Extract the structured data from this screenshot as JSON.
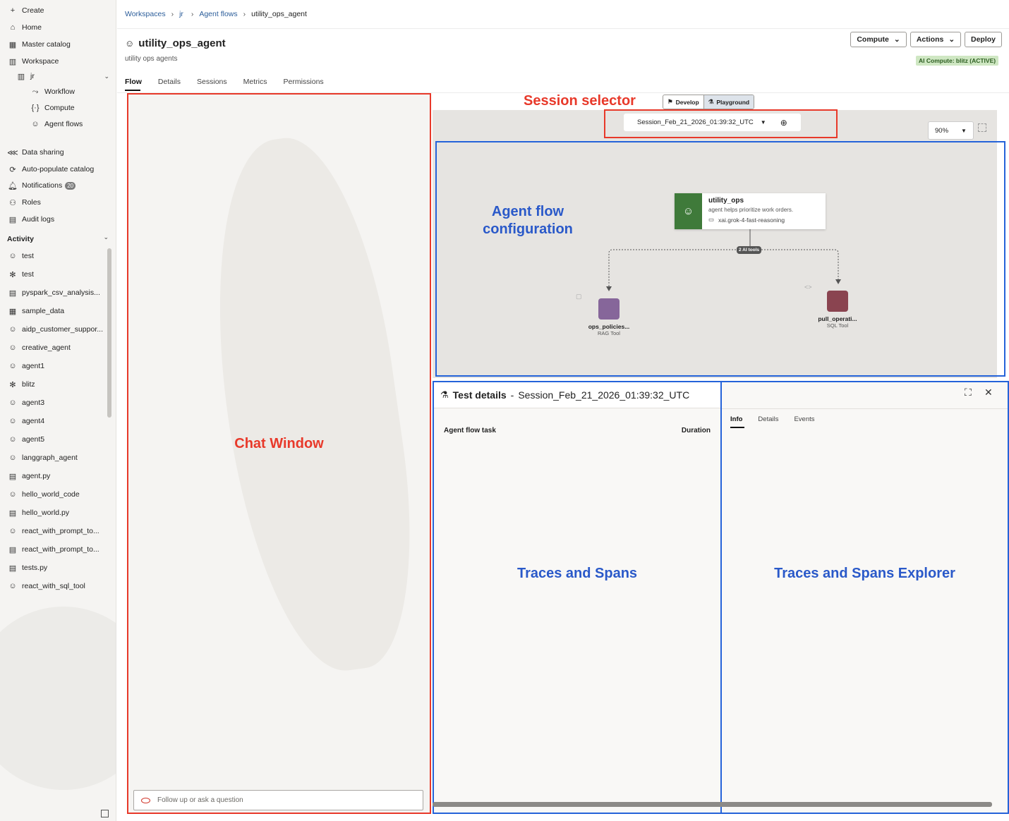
{
  "sidebar": {
    "top_items": [
      {
        "label": "Create",
        "icon": "plus-icon"
      },
      {
        "label": "Home",
        "icon": "home-icon"
      },
      {
        "label": "Master catalog",
        "icon": "catalog-icon"
      },
      {
        "label": "Workspace",
        "icon": "workspace-icon"
      }
    ],
    "workspace_tree": {
      "root": "jr",
      "children": [
        "Workflow",
        "Compute",
        "Agent flows"
      ]
    },
    "mid_items": [
      {
        "label": "Data sharing",
        "icon": "share-icon"
      },
      {
        "label": "Auto-populate catalog",
        "icon": "auto-populate-icon"
      },
      {
        "label": "Notifications",
        "icon": "bell-icon",
        "badge": "20"
      },
      {
        "label": "Roles",
        "icon": "roles-icon"
      },
      {
        "label": "Audit logs",
        "icon": "audit-log-icon"
      }
    ],
    "activity_title": "Activity",
    "activity_items": [
      {
        "label": "test",
        "icon": "agent-icon"
      },
      {
        "label": "test",
        "icon": "cluster-icon"
      },
      {
        "label": "pyspark_csv_analysis...",
        "icon": "notebook-icon"
      },
      {
        "label": "sample_data",
        "icon": "table-icon"
      },
      {
        "label": "aidp_customer_suppor...",
        "icon": "agent-icon"
      },
      {
        "label": "creative_agent",
        "icon": "agent-icon"
      },
      {
        "label": "agent1",
        "icon": "agent-icon"
      },
      {
        "label": "blitz",
        "icon": "cluster-icon"
      },
      {
        "label": "agent3",
        "icon": "agent-icon"
      },
      {
        "label": "agent4",
        "icon": "agent-icon"
      },
      {
        "label": "agent5",
        "icon": "agent-icon"
      },
      {
        "label": "langgraph_agent",
        "icon": "agent-icon"
      },
      {
        "label": "agent.py",
        "icon": "notebook-icon"
      },
      {
        "label": "hello_world_code",
        "icon": "agent-icon"
      },
      {
        "label": "hello_world.py",
        "icon": "notebook-icon"
      },
      {
        "label": "react_with_prompt_to...",
        "icon": "agent-icon"
      },
      {
        "label": "react_with_prompt_to...",
        "icon": "notebook-icon"
      },
      {
        "label": "tests.py",
        "icon": "notebook-icon"
      },
      {
        "label": "react_with_sql_tool",
        "icon": "agent-icon"
      }
    ]
  },
  "breadcrumb": {
    "items": [
      "Workspaces",
      "jr",
      "Agent flows",
      "utility_ops_agent"
    ]
  },
  "header": {
    "title": "utility_ops_agent",
    "subtitle": "utility ops agents",
    "compute_label": "Compute",
    "actions_label": "Actions",
    "deploy_label": "Deploy",
    "compute_status": "AI Compute: blitz (ACTIVE)"
  },
  "tabs": [
    "Flow",
    "Details",
    "Sessions",
    "Metrics",
    "Permissions"
  ],
  "annotations": {
    "chat": "Chat Window",
    "session": "Session selector",
    "flow": "Agent flow configuration",
    "traces": "Traces and Spans",
    "explorer": "Traces and Spans Explorer"
  },
  "chat": {
    "placeholder": "Follow up or ask a question"
  },
  "mode_toggle": {
    "develop": "Develop",
    "playground": "Playground"
  },
  "session": {
    "selected": "Session_Feb_21_2026_01:39:32_UTC"
  },
  "zoom": {
    "value": "90%"
  },
  "flow": {
    "agent": {
      "name": "utility_ops",
      "description": "agent helps prioritize work orders.",
      "model": "xai.grok-4-fast-reasoning",
      "color": "#3f7a3a"
    },
    "tools_pill": "2 AI tools",
    "tools": [
      {
        "name": "ops_policies...",
        "type": "RAG Tool",
        "color": "#86669a"
      },
      {
        "name": "pull_operati...",
        "type": "SQL Tool",
        "color": "#8a4450"
      }
    ]
  },
  "test_details": {
    "title": "Test details",
    "session": "Session_Feb_21_2026_01:39:32_UTC",
    "col_task": "Agent flow task",
    "col_duration": "Duration"
  },
  "explorer": {
    "tabs": [
      "Info",
      "Details",
      "Events"
    ]
  }
}
